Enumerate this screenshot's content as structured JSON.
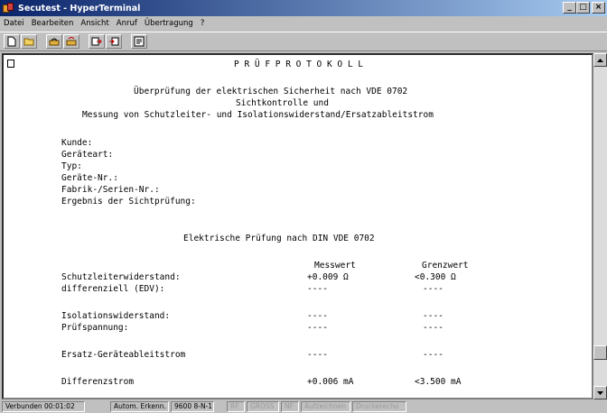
{
  "window": {
    "title": "Secutest - HyperTerminal"
  },
  "menu": [
    "Datei",
    "Bearbeiten",
    "Ansicht",
    "Anruf",
    "Übertragung",
    "?"
  ],
  "toolbar": [
    "new-icon",
    "open-icon",
    "connect-icon",
    "disconnect-icon",
    "send-icon",
    "receive-icon",
    "properties-icon"
  ],
  "terminal": {
    "heading": "P R Ü F P R O T O K O L L",
    "subtitle1": "Überprüfung der elektrischen Sicherheit nach VDE 0702",
    "subtitle2": "Sichtkontrolle und",
    "subtitle3": "Messung von Schutzleiter- und Isolationswiderstand/Ersatzableitstrom",
    "fields": {
      "kunde": "Kunde:",
      "geraeteart": "Geräteart:",
      "typ": "Typ:",
      "geraete_nr": "Geräte-Nr.:",
      "fabrik_nr": "Fabrik-/Serien-Nr.:",
      "sichtpruefung": "Ergebnis der Sichtprüfung:"
    },
    "section_title": "Elektrische Prüfung nach DIN VDE 0702",
    "col_messwert": "Messwert",
    "col_grenzwert": "Grenzwert",
    "rows": [
      {
        "label": "Schutzleiterwiderstand:",
        "messwert": "+0.009 Ω",
        "grenzwert": "<0.300 Ω"
      },
      {
        "label": "differenziell (EDV):",
        "messwert": "----",
        "grenzwert": "----"
      },
      {
        "label": "Isolationswiderstand:",
        "messwert": "----",
        "grenzwert": "----"
      },
      {
        "label": "Prüfspannung:",
        "messwert": "----",
        "grenzwert": "----"
      },
      {
        "label": "Ersatz-Geräteableitstrom",
        "messwert": "----",
        "grenzwert": "----"
      },
      {
        "label": "Differenzstrom",
        "messwert": "+0.006 mA",
        "grenzwert": "<3.500 mA"
      }
    ]
  },
  "status": {
    "connected": "Verbunden 00:01:02",
    "detect": "Autom. Erkenn.",
    "port": "9600 8-N-1",
    "rf": "RF",
    "gross": "GROSS",
    "nf": "NF",
    "aufzeichnen": "Aufzeichnen",
    "druckerecho": "Druckerecho"
  }
}
